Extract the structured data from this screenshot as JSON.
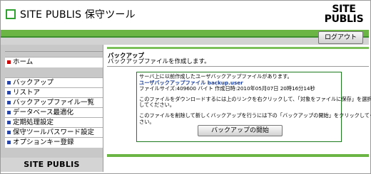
{
  "header": {
    "title": "SITE PUBLIS 保守ツール",
    "logo_line1": "SITE",
    "logo_line2": "PUBLIS"
  },
  "toolbar": {
    "logout_label": "ログアウト"
  },
  "sidebar": {
    "items": [
      {
        "label": "ホーム",
        "color": "#c80000"
      },
      {
        "label": "バックアップ",
        "color": "#2a46a6"
      },
      {
        "label": "リストア",
        "color": "#2a46a6"
      },
      {
        "label": "バックアップファイル一覧",
        "color": "#2a46a6"
      },
      {
        "label": "データベース最適化",
        "color": "#2a46a6"
      },
      {
        "label": "定期処理設定",
        "color": "#2a46a6"
      },
      {
        "label": "保守ツールパスワード設定",
        "color": "#2a46a6"
      },
      {
        "label": "オプションキー登録",
        "color": "#2a46a6"
      }
    ],
    "footer_logo": "SITE PUBLIS"
  },
  "main": {
    "breadcrumb": "バックアップ",
    "description": "バックアップファイルを作成します。",
    "notice": {
      "line1": "サーバ上に以前作成したユーザバックアップファイルがあります。",
      "filename": "ユーザバックアップファイル backup.user",
      "fileinfo": "ファイルサイズ:409600 バイト 作成日時:2010年05月07日 20時16分14秒",
      "line3": "このファイルをダウンロードするには上のリンクを右クリックして、「対象をファイルに保存」を選択",
      "line4": "してください。",
      "line5": "このファイルを削除して新しくバックアップを行うには下の「バックアップの開始」をクリックしてくだ",
      "line6": "さい。",
      "button_label": "バックアップの開始"
    }
  },
  "colors": {
    "accent_green": "#6ab544",
    "link_blue": "#1a3f9e",
    "home_bullet": "#c80000"
  }
}
